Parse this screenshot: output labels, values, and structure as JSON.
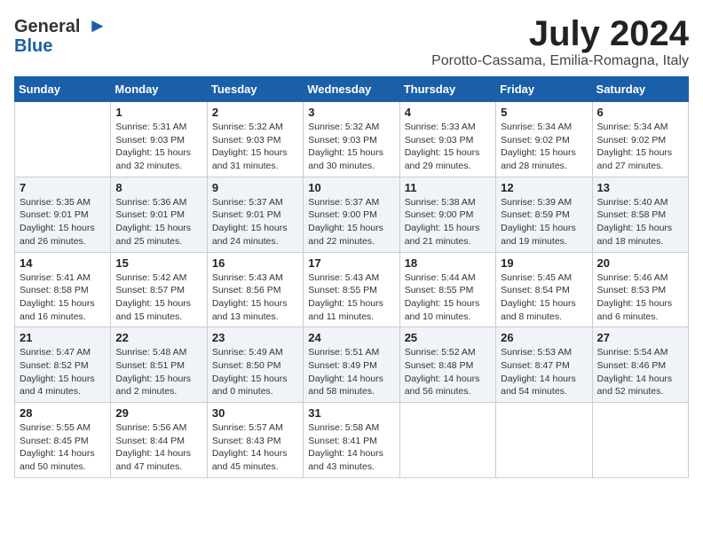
{
  "logo": {
    "general": "General",
    "blue": "Blue"
  },
  "title": "July 2024",
  "location": "Porotto-Cassama, Emilia-Romagna, Italy",
  "days_of_week": [
    "Sunday",
    "Monday",
    "Tuesday",
    "Wednesday",
    "Thursday",
    "Friday",
    "Saturday"
  ],
  "weeks": [
    [
      {
        "day": "",
        "info": ""
      },
      {
        "day": "1",
        "info": "Sunrise: 5:31 AM\nSunset: 9:03 PM\nDaylight: 15 hours\nand 32 minutes."
      },
      {
        "day": "2",
        "info": "Sunrise: 5:32 AM\nSunset: 9:03 PM\nDaylight: 15 hours\nand 31 minutes."
      },
      {
        "day": "3",
        "info": "Sunrise: 5:32 AM\nSunset: 9:03 PM\nDaylight: 15 hours\nand 30 minutes."
      },
      {
        "day": "4",
        "info": "Sunrise: 5:33 AM\nSunset: 9:03 PM\nDaylight: 15 hours\nand 29 minutes."
      },
      {
        "day": "5",
        "info": "Sunrise: 5:34 AM\nSunset: 9:02 PM\nDaylight: 15 hours\nand 28 minutes."
      },
      {
        "day": "6",
        "info": "Sunrise: 5:34 AM\nSunset: 9:02 PM\nDaylight: 15 hours\nand 27 minutes."
      }
    ],
    [
      {
        "day": "7",
        "info": "Sunrise: 5:35 AM\nSunset: 9:01 PM\nDaylight: 15 hours\nand 26 minutes."
      },
      {
        "day": "8",
        "info": "Sunrise: 5:36 AM\nSunset: 9:01 PM\nDaylight: 15 hours\nand 25 minutes."
      },
      {
        "day": "9",
        "info": "Sunrise: 5:37 AM\nSunset: 9:01 PM\nDaylight: 15 hours\nand 24 minutes."
      },
      {
        "day": "10",
        "info": "Sunrise: 5:37 AM\nSunset: 9:00 PM\nDaylight: 15 hours\nand 22 minutes."
      },
      {
        "day": "11",
        "info": "Sunrise: 5:38 AM\nSunset: 9:00 PM\nDaylight: 15 hours\nand 21 minutes."
      },
      {
        "day": "12",
        "info": "Sunrise: 5:39 AM\nSunset: 8:59 PM\nDaylight: 15 hours\nand 19 minutes."
      },
      {
        "day": "13",
        "info": "Sunrise: 5:40 AM\nSunset: 8:58 PM\nDaylight: 15 hours\nand 18 minutes."
      }
    ],
    [
      {
        "day": "14",
        "info": "Sunrise: 5:41 AM\nSunset: 8:58 PM\nDaylight: 15 hours\nand 16 minutes."
      },
      {
        "day": "15",
        "info": "Sunrise: 5:42 AM\nSunset: 8:57 PM\nDaylight: 15 hours\nand 15 minutes."
      },
      {
        "day": "16",
        "info": "Sunrise: 5:43 AM\nSunset: 8:56 PM\nDaylight: 15 hours\nand 13 minutes."
      },
      {
        "day": "17",
        "info": "Sunrise: 5:43 AM\nSunset: 8:55 PM\nDaylight: 15 hours\nand 11 minutes."
      },
      {
        "day": "18",
        "info": "Sunrise: 5:44 AM\nSunset: 8:55 PM\nDaylight: 15 hours\nand 10 minutes."
      },
      {
        "day": "19",
        "info": "Sunrise: 5:45 AM\nSunset: 8:54 PM\nDaylight: 15 hours\nand 8 minutes."
      },
      {
        "day": "20",
        "info": "Sunrise: 5:46 AM\nSunset: 8:53 PM\nDaylight: 15 hours\nand 6 minutes."
      }
    ],
    [
      {
        "day": "21",
        "info": "Sunrise: 5:47 AM\nSunset: 8:52 PM\nDaylight: 15 hours\nand 4 minutes."
      },
      {
        "day": "22",
        "info": "Sunrise: 5:48 AM\nSunset: 8:51 PM\nDaylight: 15 hours\nand 2 minutes."
      },
      {
        "day": "23",
        "info": "Sunrise: 5:49 AM\nSunset: 8:50 PM\nDaylight: 15 hours\nand 0 minutes."
      },
      {
        "day": "24",
        "info": "Sunrise: 5:51 AM\nSunset: 8:49 PM\nDaylight: 14 hours\nand 58 minutes."
      },
      {
        "day": "25",
        "info": "Sunrise: 5:52 AM\nSunset: 8:48 PM\nDaylight: 14 hours\nand 56 minutes."
      },
      {
        "day": "26",
        "info": "Sunrise: 5:53 AM\nSunset: 8:47 PM\nDaylight: 14 hours\nand 54 minutes."
      },
      {
        "day": "27",
        "info": "Sunrise: 5:54 AM\nSunset: 8:46 PM\nDaylight: 14 hours\nand 52 minutes."
      }
    ],
    [
      {
        "day": "28",
        "info": "Sunrise: 5:55 AM\nSunset: 8:45 PM\nDaylight: 14 hours\nand 50 minutes."
      },
      {
        "day": "29",
        "info": "Sunrise: 5:56 AM\nSunset: 8:44 PM\nDaylight: 14 hours\nand 47 minutes."
      },
      {
        "day": "30",
        "info": "Sunrise: 5:57 AM\nSunset: 8:43 PM\nDaylight: 14 hours\nand 45 minutes."
      },
      {
        "day": "31",
        "info": "Sunrise: 5:58 AM\nSunset: 8:41 PM\nDaylight: 14 hours\nand 43 minutes."
      },
      {
        "day": "",
        "info": ""
      },
      {
        "day": "",
        "info": ""
      },
      {
        "day": "",
        "info": ""
      }
    ]
  ]
}
